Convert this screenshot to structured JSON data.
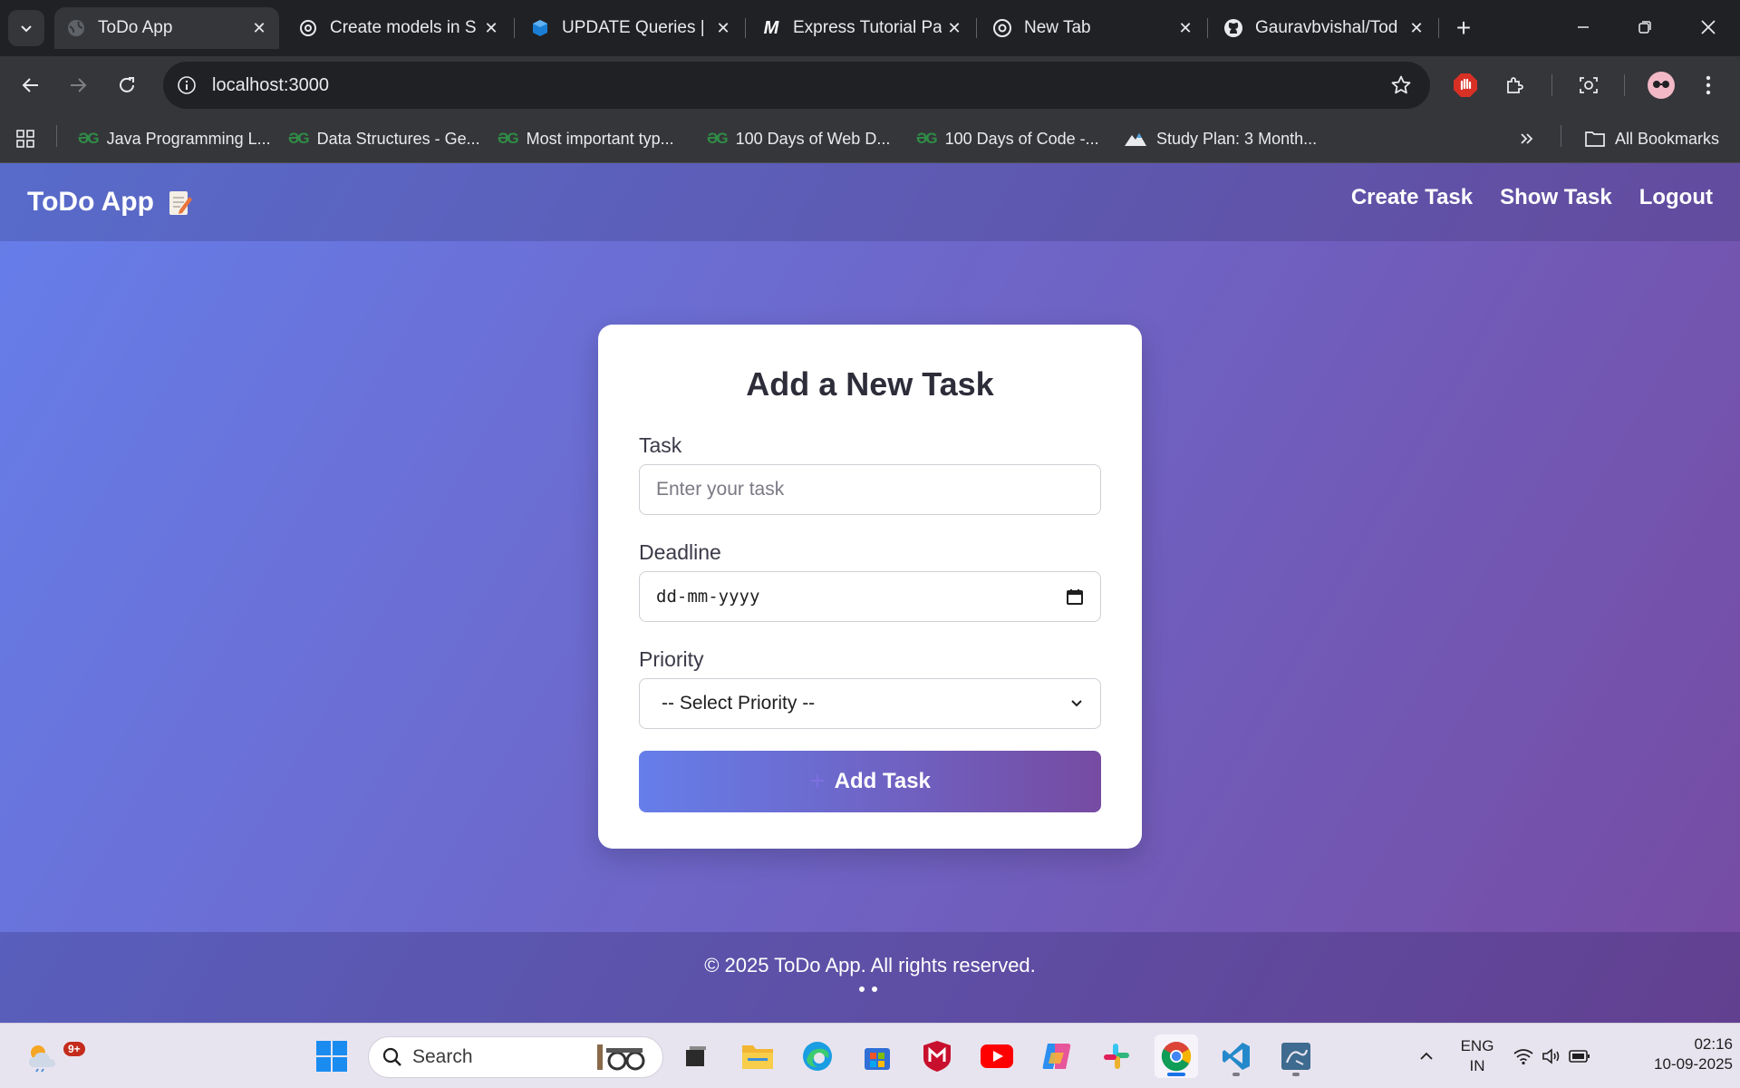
{
  "browser": {
    "tabs": [
      {
        "title": "ToDo App",
        "icon": "globe-icon",
        "active": true
      },
      {
        "title": "Create models in S",
        "icon": "openai-icon",
        "active": false
      },
      {
        "title": "UPDATE Queries | S",
        "icon": "cube-icon",
        "active": false
      },
      {
        "title": "Express Tutorial Pa",
        "icon": "m-logo-icon",
        "active": false
      },
      {
        "title": "New Tab",
        "icon": "chrome-icon",
        "active": false
      },
      {
        "title": "Gauravbvishal/Tod",
        "icon": "github-icon",
        "active": false
      }
    ],
    "url": "localhost:3000",
    "bookmarks": [
      {
        "label": "Java Programming L...",
        "icon": "gfg-icon"
      },
      {
        "label": "Data Structures - Ge...",
        "icon": "gfg-icon"
      },
      {
        "label": "Most important typ...",
        "icon": "gfg-icon"
      },
      {
        "label": "100 Days of Web D...",
        "icon": "gfg-icon"
      },
      {
        "label": "100 Days of Code -...",
        "icon": "gfg-icon"
      },
      {
        "label": "Study Plan: 3 Month...",
        "icon": "mountain-icon"
      }
    ],
    "all_bookmarks": "All Bookmarks"
  },
  "app": {
    "brand": "ToDo App",
    "nav": {
      "create": "Create Task",
      "show": "Show Task",
      "logout": "Logout"
    },
    "form": {
      "title": "Add a New Task",
      "task_label": "Task",
      "task_placeholder": "Enter your task",
      "deadline_label": "Deadline",
      "deadline_placeholder": "dd-mm-yyyy",
      "priority_label": "Priority",
      "priority_selected": "-- Select Priority --",
      "submit_label": "Add Task"
    },
    "footer": "© 2025 ToDo App. All rights reserved."
  },
  "taskbar": {
    "search_label": "Search",
    "weather_badge": "9+",
    "lang_line1": "ENG",
    "lang_line2": "IN",
    "time": "02:16",
    "date": "10-09-2025"
  },
  "colors": {
    "gradient_start": "#667eea",
    "gradient_end": "#764ba2",
    "chrome_dark": "#202124",
    "chrome_toolbar": "#35363a"
  }
}
